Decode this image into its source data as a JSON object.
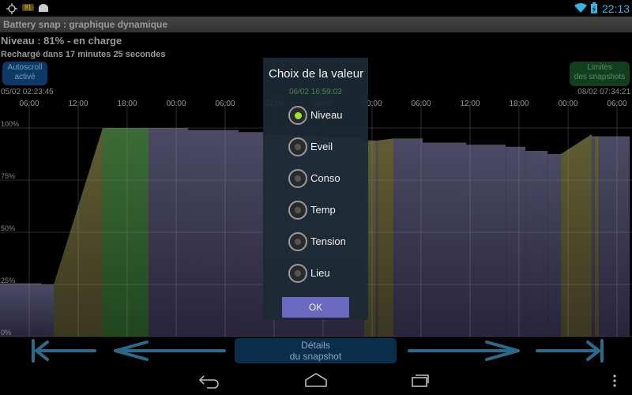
{
  "status_bar": {
    "battery_badge": "81",
    "time": "22:13",
    "icons": [
      "gps-icon",
      "battery-badge-icon",
      "android-icon",
      "wifi-icon",
      "battery-charging-icon"
    ]
  },
  "app": {
    "title": "Battery snap : graphique dynamique"
  },
  "info": {
    "level": "Niveau : 81% - en charge",
    "recharge": "Rechargé dans 17 minutes 25 secondes"
  },
  "buttons": {
    "autoscroll_line1": "Autoscroll",
    "autoscroll_line2": "activé",
    "limits_line1": "Limites",
    "limits_line2": "des snapshots",
    "details_line1": "Détails",
    "details_line2": "du snapshot"
  },
  "timeline": {
    "start": "05/02 02:23:45",
    "cursor": "06/02 16:59:03",
    "end": "08/02 07:34:21"
  },
  "dialog": {
    "title": "Choix de la valeur",
    "options": [
      "Niveau",
      "Eveil",
      "Conso",
      "Temp",
      "Tension",
      "Lieu"
    ],
    "selected": 0,
    "ok_label": "OK"
  },
  "colors": {
    "discharge": "#4a4862",
    "charge": "#5e5a30",
    "full": "#3a6a35",
    "accent": "#9ae62a",
    "ok": "#6a68c0"
  },
  "chart_data": {
    "type": "area",
    "x_ticks": [
      "06:00",
      "12:00",
      "18:00",
      "00:00",
      "06:00",
      "12:00",
      "18:00",
      "00:00",
      "06:00",
      "12:00",
      "18:00",
      "00:00",
      "06:00"
    ],
    "y_ticks": [
      "100%",
      "75%",
      "50%",
      "25%",
      "0%"
    ],
    "ylim": [
      0,
      100
    ],
    "grid": true,
    "segments": [
      {
        "state": "discharge",
        "from": "05/02 02:23",
        "to": "05/02 07:30",
        "level": [
          25.5,
          25.5
        ]
      },
      {
        "state": "discharge",
        "from": "05/02 07:30",
        "to": "05/02 09:00",
        "level": [
          25,
          25
        ]
      },
      {
        "state": "charge",
        "from": "05/02 09:00",
        "to": "05/02 15:00",
        "level": [
          25,
          100
        ]
      },
      {
        "state": "full",
        "from": "05/02 15:00",
        "to": "05/02 20:37",
        "level": [
          100,
          100
        ]
      },
      {
        "state": "discharge",
        "from": "05/02 20:37",
        "to": "06/02 01:27",
        "level": [
          100,
          100
        ]
      },
      {
        "state": "discharge",
        "from": "06/02 01:27",
        "to": "06/02 07:39",
        "level": [
          99,
          99
        ]
      },
      {
        "state": "discharge",
        "from": "06/02 07:39",
        "to": "06/02 10:39",
        "level": [
          98,
          98
        ]
      },
      {
        "state": "discharge",
        "from": "06/02 10:39",
        "to": "06/02 23:00",
        "level": [
          97,
          95
        ]
      },
      {
        "state": "charge",
        "from": "06/02 23:00",
        "to": "07/02 00:29",
        "level": [
          94,
          94
        ]
      },
      {
        "state": "discharge",
        "from": "07/02 00:29",
        "to": "07/02 00:41",
        "level": [
          94,
          94
        ]
      },
      {
        "state": "charge",
        "from": "07/02 00:41",
        "to": "07/02 02:37",
        "level": [
          94,
          95
        ]
      },
      {
        "state": "discharge",
        "from": "07/02 02:37",
        "to": "07/02 06:12",
        "level": [
          95,
          95
        ]
      },
      {
        "state": "discharge",
        "from": "07/02 06:12",
        "to": "07/02 11:31",
        "level": [
          93,
          93
        ]
      },
      {
        "state": "discharge",
        "from": "07/02 11:31",
        "to": "07/02 16:22",
        "level": [
          92,
          92
        ]
      },
      {
        "state": "discharge",
        "from": "07/02 16:22",
        "to": "07/02 18:47",
        "level": [
          91,
          91
        ]
      },
      {
        "state": "discharge",
        "from": "07/02 18:47",
        "to": "07/02 21:30",
        "level": [
          89,
          89
        ]
      },
      {
        "state": "discharge",
        "from": "07/02 21:30",
        "to": "07/02 23:08",
        "level": [
          87.5,
          87.5
        ]
      },
      {
        "state": "charge",
        "from": "07/02 23:08",
        "to": "08/02 02:54",
        "level": [
          87.5,
          97
        ]
      },
      {
        "state": "discharge",
        "from": "08/02 02:54",
        "to": "08/02 03:17",
        "level": [
          96,
          96
        ]
      },
      {
        "state": "charge",
        "from": "08/02 03:17",
        "to": "08/02 03:47",
        "level": [
          96,
          96
        ]
      },
      {
        "state": "discharge",
        "from": "08/02 03:47",
        "to": "08/02 07:34",
        "level": [
          96,
          96
        ]
      }
    ]
  }
}
